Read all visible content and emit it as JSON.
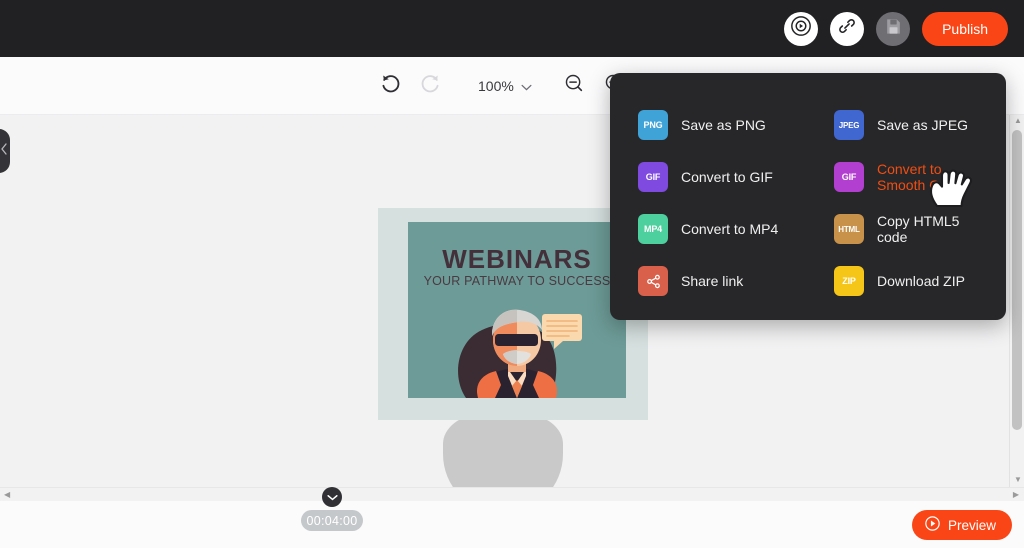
{
  "topbar": {
    "actions": [
      {
        "name": "record-button",
        "icon": "play-circle-icon"
      },
      {
        "name": "link-button",
        "icon": "link-icon"
      },
      {
        "name": "save-button",
        "icon": "floppy-disk-icon"
      }
    ],
    "publish_label": "Publish"
  },
  "toolbar": {
    "undo_icon": "undo-icon",
    "redo_icon": "redo-icon",
    "zoom_level": "100%",
    "zoom_chevron_icon": "chevron-down-icon",
    "zoom_out_icon": "zoom-out-icon",
    "zoom_in_icon": "zoom-in-icon",
    "panel_toggle_icon": "chevron-left-icon"
  },
  "canvas": {
    "slide": {
      "title": "WEBINARS",
      "subtitle": "YOUR PATHWAY TO SUCCESS",
      "bg_color": "#6d9b97",
      "frame_color": "#d6e0df",
      "title_color": "#43303a"
    }
  },
  "export_menu": {
    "items": [
      {
        "label": "Save as PNG",
        "badge": "PNG",
        "color": "#3fa3d8",
        "icon": "png-file-icon",
        "highlighted": false
      },
      {
        "label": "Save as JPEG",
        "badge": "JPEG",
        "color": "#4066d0",
        "icon": "jpeg-file-icon",
        "highlighted": false
      },
      {
        "label": "Convert to GIF",
        "badge": "GIF",
        "color": "#7e4ae0",
        "icon": "gif-file-icon",
        "highlighted": false
      },
      {
        "label": "Convert to Smooth GIF",
        "badge": "GIF",
        "color": "#b33fd0",
        "icon": "smooth-gif-file-icon",
        "highlighted": true
      },
      {
        "label": "Convert to MP4",
        "badge": "MP4",
        "color": "#4ecf9e",
        "icon": "mp4-file-icon",
        "highlighted": false
      },
      {
        "label": "Copy HTML5 code",
        "badge": "HTML",
        "color": "#c8924a",
        "icon": "html5-file-icon",
        "highlighted": false
      },
      {
        "label": "Share link",
        "badge": "",
        "color": "#d9604a",
        "icon": "share-nodes-icon",
        "highlighted": false
      },
      {
        "label": "Download ZIP",
        "badge": "ZIP",
        "color": "#f5c518",
        "icon": "zip-file-icon",
        "highlighted": false
      }
    ],
    "highlight_color": "#f04e12",
    "bg_color": "#27272a"
  },
  "timeline": {
    "timecode": "00:04:00",
    "handle_icon": "chevron-down-icon",
    "preview_label": "Preview",
    "preview_icon": "play-circle-icon"
  },
  "scrollbars": {
    "left_arrow_icon": "triangle-left-icon",
    "right_arrow_icon": "triangle-right-icon",
    "up_arrow_icon": "triangle-up-icon",
    "down_arrow_icon": "triangle-down-icon"
  }
}
